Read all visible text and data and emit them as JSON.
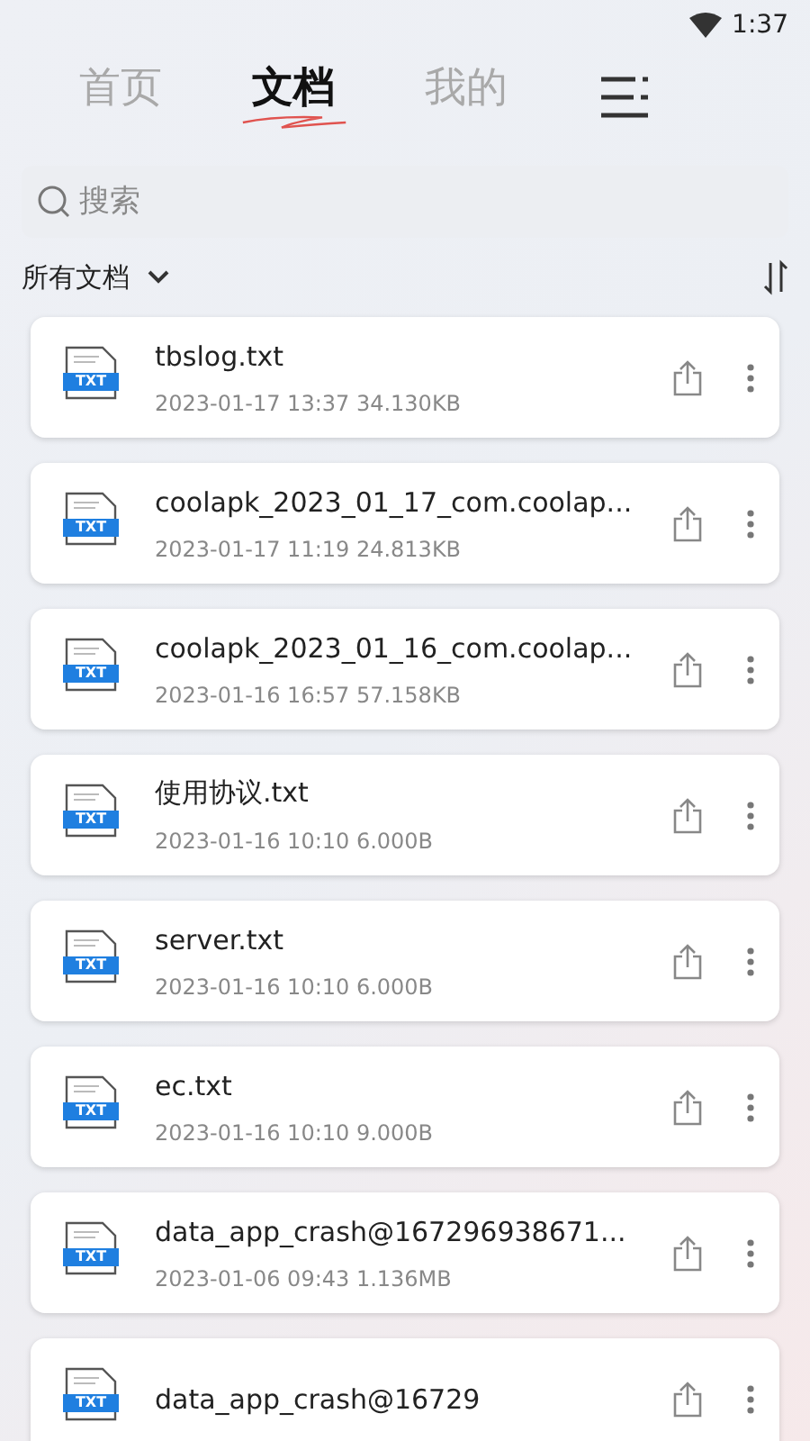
{
  "status_bar": {
    "time": "1:37"
  },
  "tabs": [
    {
      "label": "首页",
      "selected": false
    },
    {
      "label": "文档",
      "selected": true
    },
    {
      "label": "我的",
      "selected": false
    }
  ],
  "search": {
    "placeholder": "搜索"
  },
  "filter": {
    "label": "所有文档"
  },
  "files": [
    {
      "name": "tbslog.txt",
      "meta": "2023-01-17 13:37 34.130KB",
      "type": "TXT"
    },
    {
      "name": "coolapk_2023_01_17_com.coolap...",
      "meta": "2023-01-17 11:19 24.813KB",
      "type": "TXT"
    },
    {
      "name": "coolapk_2023_01_16_com.coolap...",
      "meta": "2023-01-16 16:57 57.158KB",
      "type": "TXT"
    },
    {
      "name": "使用协议.txt",
      "meta": "2023-01-16 10:10 6.000B",
      "type": "TXT"
    },
    {
      "name": "server.txt",
      "meta": "2023-01-16 10:10 6.000B",
      "type": "TXT"
    },
    {
      "name": "ec.txt",
      "meta": "2023-01-16 10:10 9.000B",
      "type": "TXT"
    },
    {
      "name": "data_app_crash@167296938671...",
      "meta": "2023-01-06 09:43 1.136MB",
      "type": "TXT"
    },
    {
      "name": "data_app_crash@16729",
      "type": "TXT"
    }
  ]
}
